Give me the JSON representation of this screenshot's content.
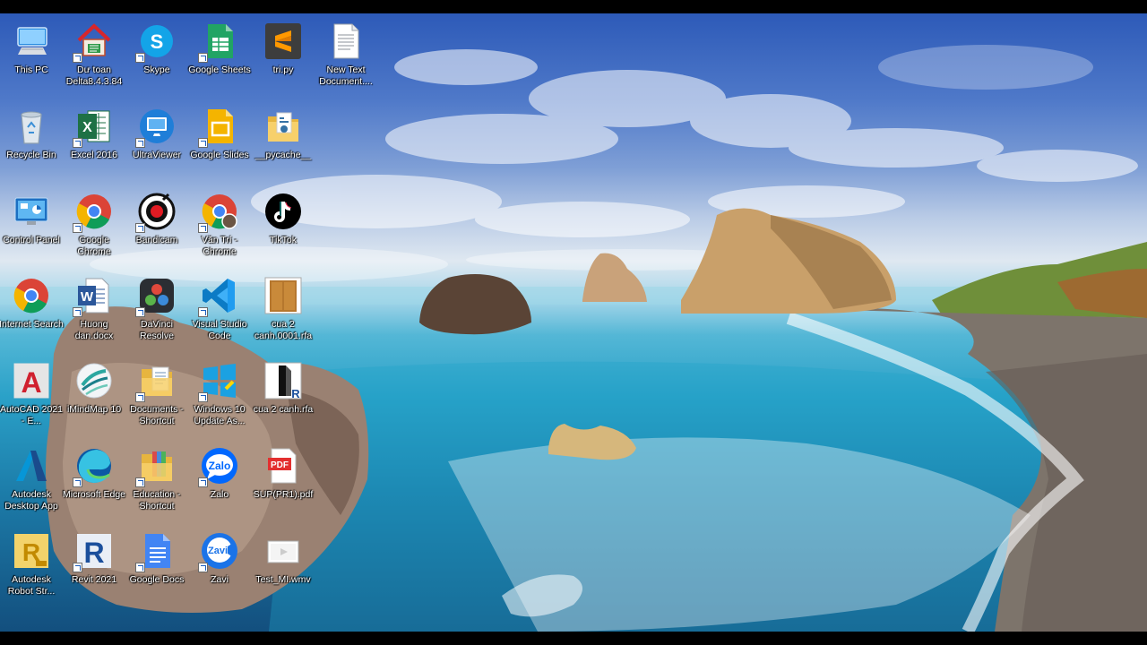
{
  "desktop": {
    "icons": [
      {
        "label": "This PC",
        "icon": "computer-icon",
        "shortcut": false
      },
      {
        "label": "Dư toan Delta8.4.3.84",
        "icon": "house-app-icon",
        "shortcut": true
      },
      {
        "label": "Skype",
        "icon": "skype-icon",
        "shortcut": true
      },
      {
        "label": "Google Sheets",
        "icon": "google-sheets-icon",
        "shortcut": true
      },
      {
        "label": "tri.py",
        "icon": "sublime-text-icon",
        "shortcut": false
      },
      {
        "label": "New Text Document....",
        "icon": "text-document-icon",
        "shortcut": false
      },
      {
        "label": "Recycle Bin",
        "icon": "recycle-bin-icon",
        "shortcut": false
      },
      {
        "label": "Excel 2016",
        "icon": "excel-icon",
        "shortcut": true
      },
      {
        "label": "UltraViewer",
        "icon": "ultraviewer-icon",
        "shortcut": true
      },
      {
        "label": "Google Slides",
        "icon": "google-slides-icon",
        "shortcut": true
      },
      {
        "label": "__pycache__",
        "icon": "folder-icon",
        "shortcut": false
      },
      {
        "label": "Control Panel",
        "icon": "control-panel-icon",
        "shortcut": false
      },
      {
        "label": "Google Chrome",
        "icon": "chrome-icon",
        "shortcut": true
      },
      {
        "label": "Bandicam",
        "icon": "bandicam-icon",
        "shortcut": true
      },
      {
        "label": "Văn Trí - Chrome",
        "icon": "chrome-profile-icon",
        "shortcut": true
      },
      {
        "label": "TikTok",
        "icon": "tiktok-icon",
        "shortcut": false
      },
      {
        "label": "Internet Search",
        "icon": "chrome-icon",
        "shortcut": false
      },
      {
        "label": "Huong dan.docx",
        "icon": "word-document-icon",
        "shortcut": true
      },
      {
        "label": "DaVinci Resolve",
        "icon": "davinci-resolve-icon",
        "shortcut": true
      },
      {
        "label": "Visual Studio Code",
        "icon": "vscode-icon",
        "shortcut": true
      },
      {
        "label": "cua 2 canh.0001.rfa",
        "icon": "door-family-icon",
        "shortcut": false
      },
      {
        "label": "AutoCAD 2021 - E...",
        "icon": "autocad-icon",
        "shortcut": false
      },
      {
        "label": "iMindMap 10",
        "icon": "imindmap-icon",
        "shortcut": false
      },
      {
        "label": "Documents - Shortcut",
        "icon": "documents-folder-icon",
        "shortcut": true
      },
      {
        "label": "Windows 10 Update As...",
        "icon": "windows-update-icon",
        "shortcut": true
      },
      {
        "label": "cua 2 canh.rfa",
        "icon": "revit-family-icon",
        "shortcut": false
      },
      {
        "label": "Autodesk Desktop App",
        "icon": "autodesk-icon",
        "shortcut": false
      },
      {
        "label": "Microsoft Edge",
        "icon": "edge-icon",
        "shortcut": true
      },
      {
        "label": "Education - Shortcut",
        "icon": "education-folder-icon",
        "shortcut": true
      },
      {
        "label": "Zalo",
        "icon": "zalo-icon",
        "shortcut": true
      },
      {
        "label": "SUP(PR1).pdf",
        "icon": "pdf-icon",
        "shortcut": false
      },
      {
        "label": "Autodesk Robot Str...",
        "icon": "robot-structural-icon",
        "shortcut": false
      },
      {
        "label": "Revit 2021",
        "icon": "revit-icon",
        "shortcut": true
      },
      {
        "label": "Google Docs",
        "icon": "google-docs-icon",
        "shortcut": true
      },
      {
        "label": "Zavi",
        "icon": "zavi-icon",
        "shortcut": true
      },
      {
        "label": "Test_MI.wmv",
        "icon": "video-file-icon",
        "shortcut": false
      }
    ]
  }
}
